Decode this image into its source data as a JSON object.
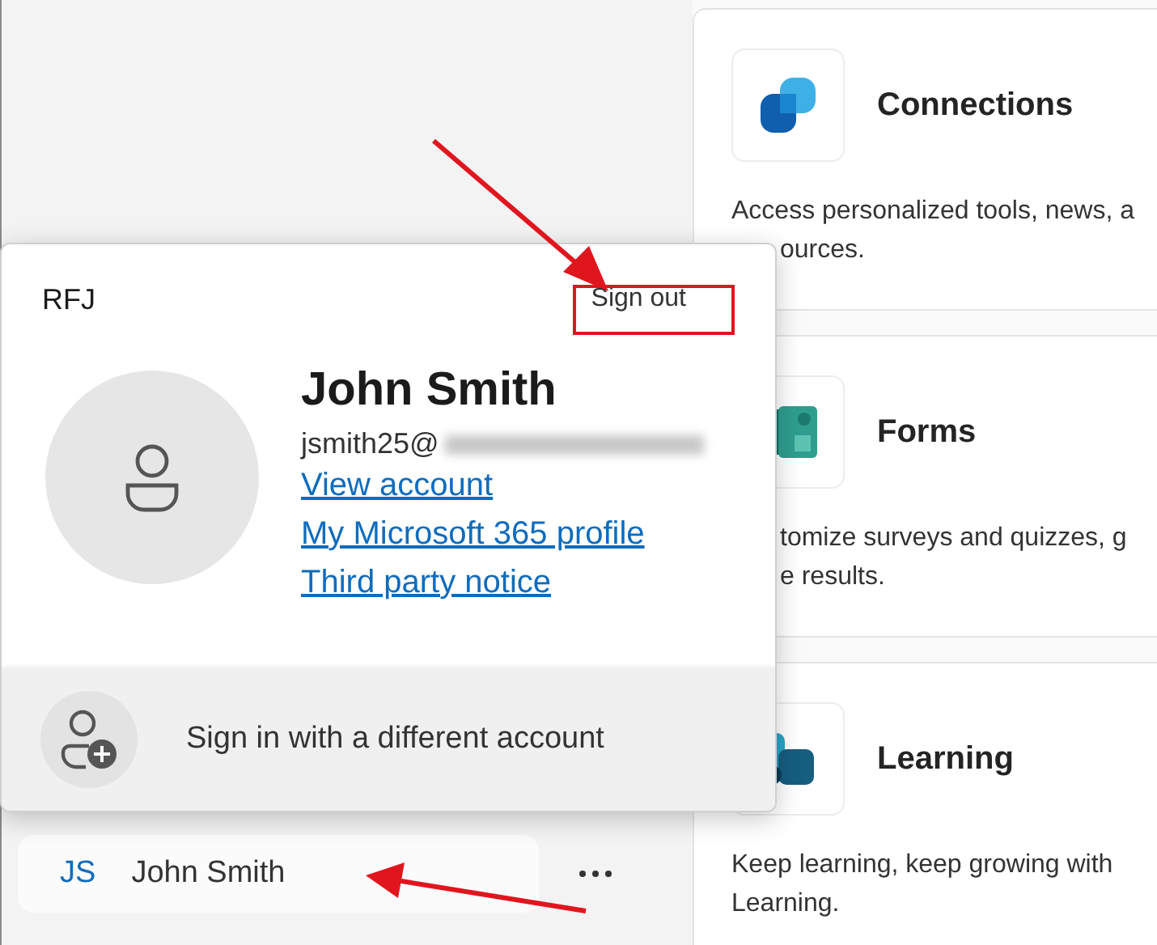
{
  "account_popup": {
    "organization": "RFJ",
    "sign_out": "Sign out",
    "name": "John Smith",
    "email": "jsmith25@",
    "links": [
      "View account",
      "My Microsoft 365 profile",
      "Third party notice"
    ],
    "other_account": "Sign in with a different account"
  },
  "sidebar": {
    "account": {
      "initials": "JS",
      "name": "John Smith"
    }
  },
  "cards": [
    {
      "kind": "connections",
      "title": "Connections",
      "lines": [
        {
          "text": "Access personalized tools, news, a",
          "covered": false
        },
        {
          "text": "ources.",
          "covered": true
        }
      ]
    },
    {
      "kind": "forms",
      "title": "Forms",
      "lines": [
        {
          "text": "tomize surveys and quizzes, g",
          "covered": true
        },
        {
          "text": "e results.",
          "covered": true
        }
      ]
    },
    {
      "kind": "learning",
      "title": "Learning",
      "lines": [
        {
          "text": "Keep learning, keep growing with",
          "covered": false
        },
        {
          "text": "Learning.",
          "covered": false
        }
      ]
    }
  ]
}
